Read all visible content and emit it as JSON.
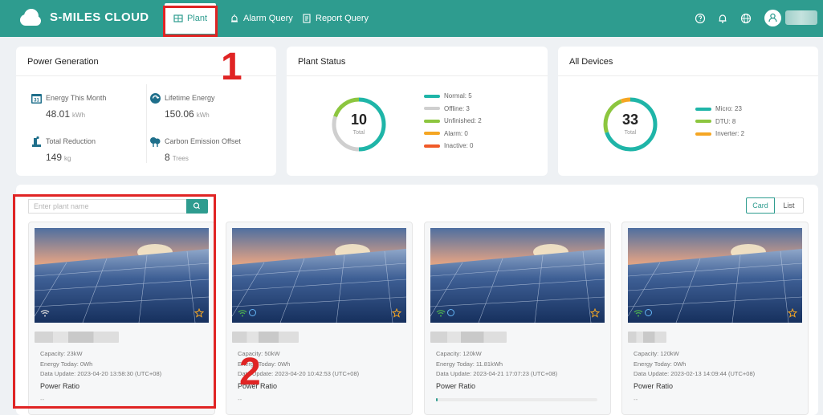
{
  "header": {
    "brand": "S-MILES CLOUD",
    "nav": [
      {
        "label": "Plant",
        "active": true
      },
      {
        "label": "Alarm Query"
      },
      {
        "label": "Report Query"
      }
    ],
    "icons": [
      "help-icon",
      "bell-icon",
      "globe-icon",
      "user-icon"
    ]
  },
  "annotations": {
    "one": "1",
    "two": "2"
  },
  "power_generation": {
    "title": "Power Generation",
    "energy_this_month": {
      "label": "Energy This Month",
      "value": "48.01",
      "unit": "kWh"
    },
    "lifetime_energy": {
      "label": "Lifetime Energy",
      "value": "150.06",
      "unit": "kWh"
    },
    "total_reduction": {
      "label": "Total Reduction",
      "value": "149",
      "unit": "kg"
    },
    "carbon_offset": {
      "label": "Carbon Emission Offset",
      "value": "8",
      "unit": "Trees"
    }
  },
  "plant_status": {
    "title": "Plant Status",
    "total": "10",
    "total_label": "Total",
    "legend": [
      {
        "label": "Normal: 5",
        "value": 5,
        "color": "#1fb5a8"
      },
      {
        "label": "Offline: 3",
        "value": 3,
        "color": "#cfcfcf"
      },
      {
        "label": "Unfinished: 2",
        "value": 2,
        "color": "#8cc63f"
      },
      {
        "label": "Alarm: 0",
        "value": 0,
        "color": "#f5a623"
      },
      {
        "label": "Inactive: 0",
        "value": 0,
        "color": "#f05a28"
      }
    ]
  },
  "all_devices": {
    "title": "All Devices",
    "total": "33",
    "total_label": "Total",
    "legend": [
      {
        "label": "Micro: 23",
        "value": 23,
        "color": "#1fb5a8"
      },
      {
        "label": "DTU: 8",
        "value": 8,
        "color": "#8cc63f"
      },
      {
        "label": "Inverter: 2",
        "value": 2,
        "color": "#f5a623"
      }
    ]
  },
  "plant_list": {
    "search_placeholder": "Enter plant name",
    "view_card": "Card",
    "view_list": "List",
    "power_ratio_label": "Power Ratio",
    "plants": [
      {
        "capacity": "Capacity: 23kW",
        "energy_today": "Energy Today: 0Wh",
        "data_update": "Data Update: 2023-04-20 13:58:30 (UTC+08)",
        "power_ratio": "--"
      },
      {
        "capacity": "Capacity: 50kW",
        "energy_today": "Energy Today: 0Wh",
        "data_update": "Data Update: 2023-04-20 10:42:53 (UTC+08)",
        "power_ratio": "--"
      },
      {
        "capacity": "Capacity: 120kW",
        "energy_today": "Energy Today: 11.81kWh",
        "data_update": "Data Update: 2023-04-21 17:07:23 (UTC+08)",
        "power_ratio": ""
      },
      {
        "capacity": "Capacity: 120kW",
        "energy_today": "Energy Today: 0Wh",
        "data_update": "Data Update: 2023-02-13 14:09:44 (UTC+08)",
        "power_ratio": "--"
      }
    ]
  }
}
